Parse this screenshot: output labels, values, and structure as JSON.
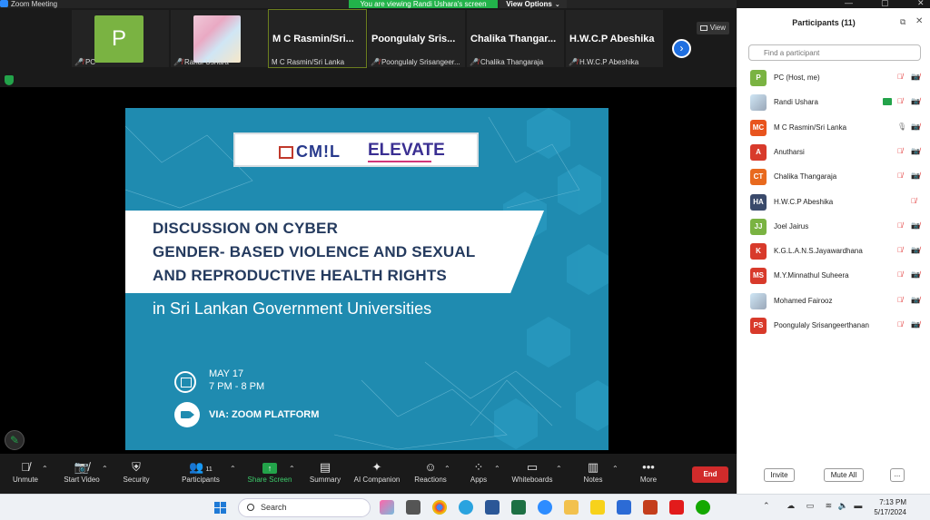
{
  "window": {
    "title": "Zoom Meeting",
    "share_banner": "You are viewing Randi Ushara's screen",
    "view_options": "View Options"
  },
  "thumbnails": [
    {
      "name": "PC",
      "avatar_letter": "P",
      "muted": true
    },
    {
      "name": "Randi Ushara",
      "muted": true,
      "has_photo": true
    },
    {
      "name": "M C Rasmin/Sri Lanka",
      "big_label": "M C Rasmin/Sri...",
      "muted": false,
      "active": true
    },
    {
      "name": "Poongulaly Srisangeer...",
      "big_label": "Poongulaly Sris...",
      "muted": true
    },
    {
      "name": "Chalika Thangaraja",
      "big_label": "Chalika Thangar...",
      "muted": true
    },
    {
      "name": "H.W.C.P Abeshika",
      "big_label": "H.W.C.P Abeshika",
      "muted": true
    }
  ],
  "view_button": "View",
  "slide": {
    "logo_left": "CM!L",
    "logo_right": "ELEVATE",
    "title_lines": [
      "DISCUSSION ON CYBER",
      "GENDER- BASED VIOLENCE AND SEXUAL",
      "AND REPRODUCTIVE HEALTH RIGHTS"
    ],
    "subtitle": "in Sri Lankan Government Universities",
    "date": "MAY 17",
    "time": "7 PM - 8 PM",
    "via": "VIA: ZOOM PLATFORM",
    "colors": {
      "background": "#1f8bb0",
      "title_text": "#243a5e"
    }
  },
  "toolbar": {
    "unmute": "Unmute",
    "start_video": "Start Video",
    "security": "Security",
    "participants": "Participants",
    "participants_count": "11",
    "share_screen": "Share Screen",
    "summary": "Summary",
    "ai_companion": "AI Companion",
    "reactions": "Reactions",
    "apps": "Apps",
    "whiteboards": "Whiteboards",
    "notes": "Notes",
    "more": "More",
    "end": "End"
  },
  "participants_panel": {
    "title": "Participants (11)",
    "search_placeholder": "Find a participant",
    "participants": [
      {
        "initials": "P",
        "name": "PC (Host, me)",
        "color": "#7ab342",
        "mic": "muted",
        "camera": "off"
      },
      {
        "initials": "",
        "name": "Randi Ushara",
        "color": "#cfe6f5",
        "photo": true,
        "sharing": true,
        "mic": "muted",
        "camera": "off"
      },
      {
        "initials": "MC",
        "name": "M C Rasmin/Sri Lanka",
        "color": "#e8541e",
        "mic": "on",
        "camera": "off"
      },
      {
        "initials": "A",
        "name": "Anutharsi",
        "color": "#d83a2b",
        "mic": "muted",
        "camera": "off"
      },
      {
        "initials": "CT",
        "name": "Chalika Thangaraja",
        "color": "#e8691e",
        "mic": "muted",
        "camera": "off"
      },
      {
        "initials": "HA",
        "name": "H.W.C.P Abeshika",
        "color": "#3a4a6b",
        "mic": "muted",
        "camera": "none"
      },
      {
        "initials": "JJ",
        "name": "Joel Jairus",
        "color": "#7ab342",
        "mic": "muted",
        "camera": "off"
      },
      {
        "initials": "K",
        "name": "K.G.L.A.N.S.Jayawardhana",
        "color": "#d83a2b",
        "mic": "muted",
        "camera": "off"
      },
      {
        "initials": "MS",
        "name": "M.Y.Minnathul Suheera",
        "color": "#d83a2b",
        "mic": "muted",
        "camera": "off"
      },
      {
        "initials": "",
        "name": "Mohamed Fairooz",
        "color": "#9aa7b8",
        "photo": true,
        "mic": "muted",
        "camera": "off"
      },
      {
        "initials": "PS",
        "name": "Poongulaly Srisangeerthanan",
        "color": "#d83a2b",
        "mic": "muted",
        "camera": "off"
      }
    ],
    "invite": "Invite",
    "mute_all": "Mute All",
    "more": "..."
  },
  "taskbar": {
    "search": "Search",
    "time": "7:13 PM",
    "date": "5/17/2024"
  }
}
